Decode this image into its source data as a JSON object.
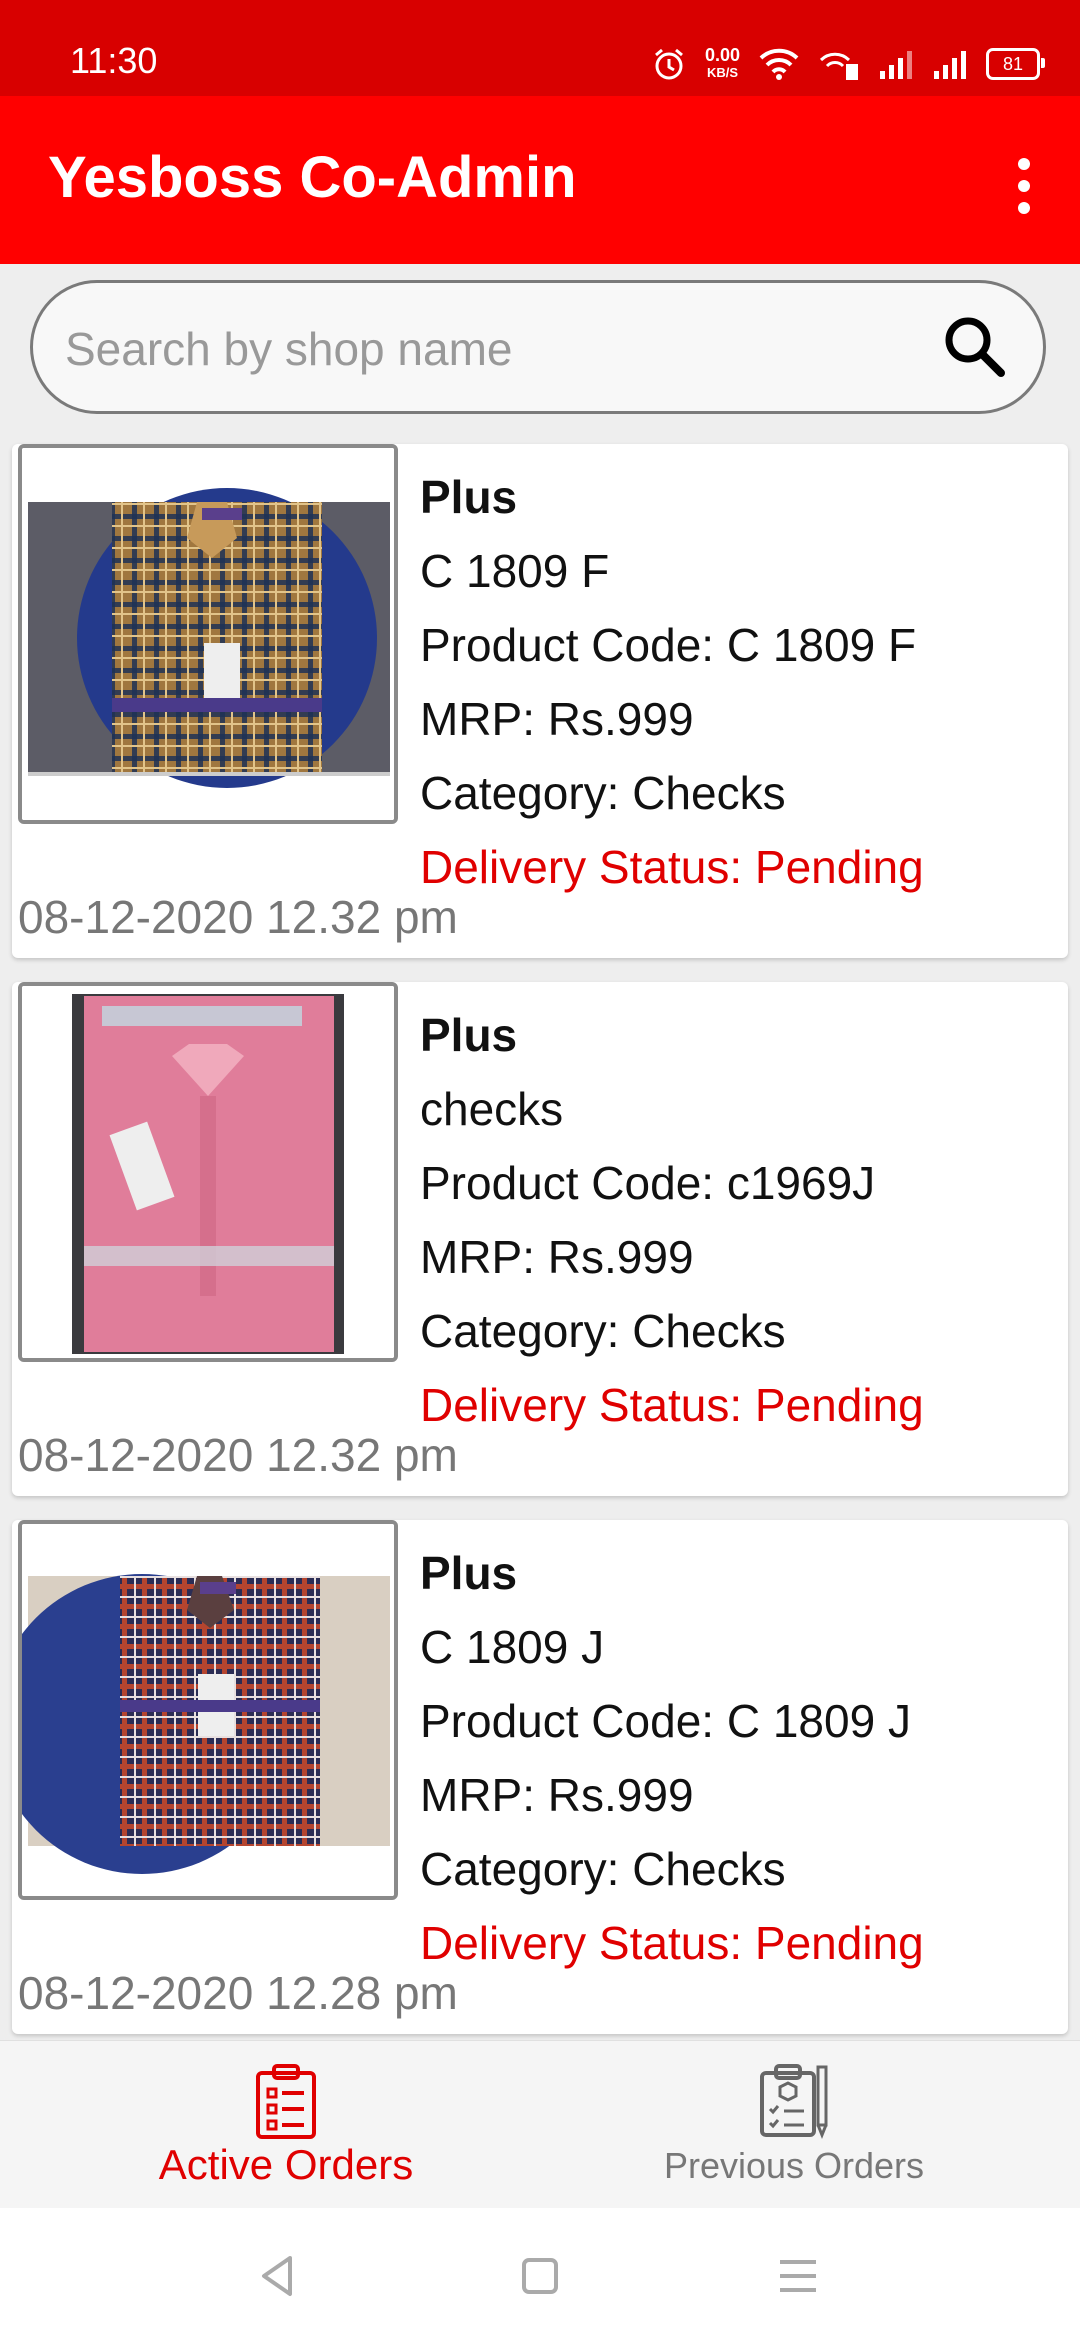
{
  "status_bar": {
    "time": "11:30",
    "net_speed_value": "0.00",
    "net_speed_unit": "KB/S",
    "battery": "81"
  },
  "app_bar": {
    "title": "Yesboss Co-Admin",
    "menu_icon": "more-vert-icon"
  },
  "search": {
    "placeholder": "Search by shop name",
    "value": "",
    "icon": "search-icon"
  },
  "orders": [
    {
      "shop": "Plus",
      "name": "C 1809 F",
      "product_code": "Product Code: C 1809 F",
      "mrp": "MRP: Rs.999",
      "category": "Category: Checks",
      "status": "Delivery Status: Pending",
      "date": "08-12-2020 12.32 pm",
      "image": "brown-checked-shirt"
    },
    {
      "shop": "Plus",
      "name": "checks",
      "product_code": "Product Code: c1969J",
      "mrp": "MRP: Rs.999",
      "category": "Category: Checks",
      "status": "Delivery Status: Pending",
      "date": "08-12-2020 12.32 pm",
      "image": "pink-shirt"
    },
    {
      "shop": "Plus",
      "name": "C 1809 J",
      "product_code": "Product Code: C 1809 J",
      "mrp": "MRP: Rs.999",
      "category": "Category: Checks",
      "status": "Delivery Status: Pending",
      "date": "08-12-2020 12.28 pm",
      "image": "red-navy-checked-shirt"
    }
  ],
  "bottom_nav": {
    "active_label": "Active Orders",
    "previous_label": "Previous Orders"
  },
  "colors": {
    "accent": "#ff0000",
    "status_bar": "#d80000",
    "status_text": "#e00000"
  }
}
